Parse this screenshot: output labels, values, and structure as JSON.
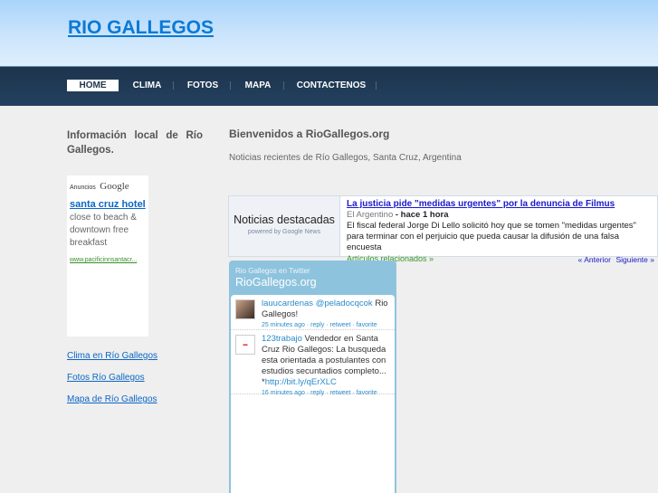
{
  "header": {
    "title": "RIO GALLEGOS"
  },
  "nav": {
    "items": [
      {
        "label": "HOME"
      },
      {
        "label": "CLIMA"
      },
      {
        "label": "FOTOS"
      },
      {
        "label": "MAPA"
      },
      {
        "label": "CONTACTENOS"
      }
    ]
  },
  "sidebar": {
    "heading": "Información local de Río Gallegos.",
    "ad": {
      "label": "Anuncios",
      "brand": "Google",
      "title": "santa cruz hotel",
      "desc": "close to beach & downtown free breakfast",
      "url": "www.pacificinnsantacr..."
    },
    "links": [
      {
        "label": "Clima en Río Gallegos"
      },
      {
        "label": "Fotos Río Gallegos"
      },
      {
        "label": "Mapa de Río Gallegos"
      }
    ]
  },
  "main": {
    "welcome": "Bienvenidos a RioGallegos.org",
    "subtitle": "Noticias recientes de Río Gallegos, Santa Cruz, Argentina"
  },
  "news": {
    "heading": "Noticias destacadas",
    "powered": "powered by Google News",
    "headline": "La justicia pide \"medidas urgentes\" por la denuncia de Filmus",
    "source": "El Argentino",
    "time": "- hace 1 hora",
    "snippet": "El fiscal federal Jorge Di Lello solicitó hoy que se tomen \"medidas urgentes\" para terminar con el perjuicio que pueda causar la difusión de una falsa encuesta",
    "related": "Artículos relacionados »",
    "prev": "« Anterior",
    "next": "Siguiente »"
  },
  "twitter": {
    "caption": "Rio Gallegos en Twitter",
    "title": "RioGallegos.org",
    "tweets": [
      {
        "user": "lauucardenas",
        "mention": "@peladocqcok",
        "text": " Rio Gallegos!",
        "link": "",
        "time": "25 minutes ago",
        "reply": "reply",
        "retweet": "retweet",
        "favorite": "favorite"
      },
      {
        "user": "123trabajo",
        "mention": "",
        "text": " Vendedor en Santa Cruz Rio Gallegos: La busqueda esta orientada a postulantes con estudios secuntadios completo... *",
        "link": "http://bit.ly/qErXLC",
        "time": "16 minutes ago",
        "reply": "reply",
        "retweet": "retweet",
        "favorite": "favorite"
      }
    ]
  }
}
